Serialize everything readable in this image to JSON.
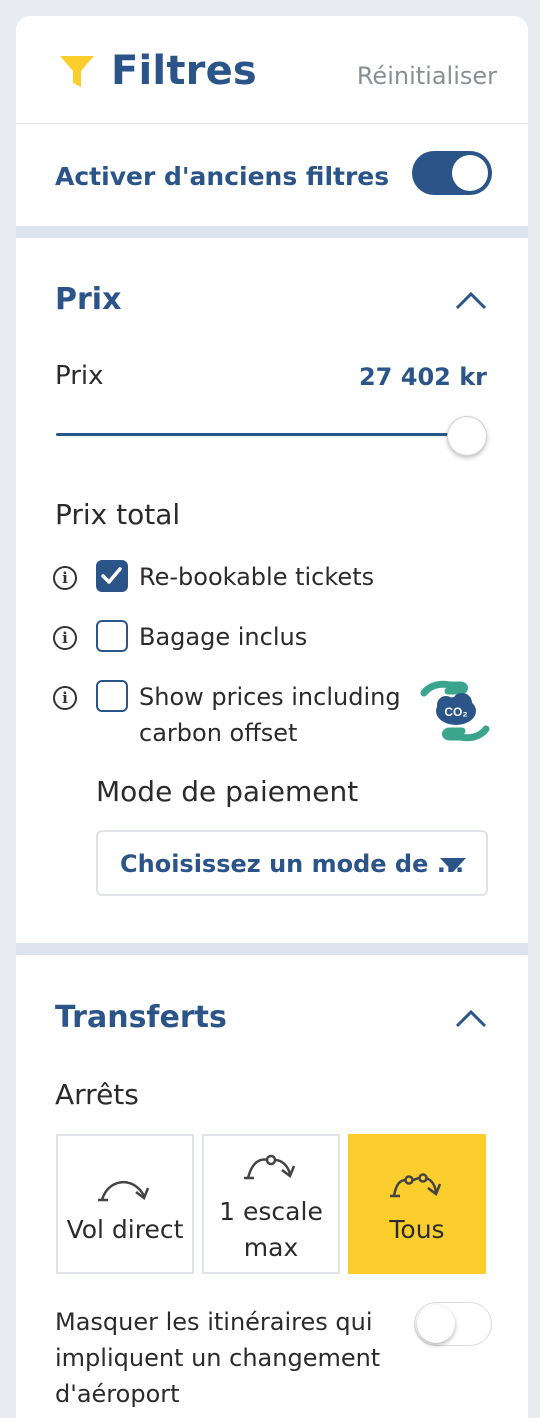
{
  "header": {
    "title": "Filtres",
    "reset_label": "Réinitialiser",
    "filter_icon": "funnel-icon",
    "accent_color": "#2b5589",
    "icon_color": "#fbcd2d"
  },
  "old_filters": {
    "label": "Activer d'anciens filtres",
    "enabled": true
  },
  "price_section": {
    "title": "Prix",
    "expanded": true,
    "price_label": "Prix",
    "price_value": "27 402 kr",
    "slider_fraction": 1.0,
    "total_label": "Prix total",
    "options": [
      {
        "label": "Re-bookable tickets",
        "checked": true,
        "icon": "info-icon"
      },
      {
        "label": "Bagage inclus",
        "checked": false,
        "icon": "info-icon"
      },
      {
        "label": "Show prices including carbon offset",
        "checked": false,
        "icon": "info-icon",
        "extra_icon": "co2-hands-icon"
      }
    ],
    "payment": {
      "label": "Mode de paiement",
      "placeholder": "Choisissez un mode de ..."
    }
  },
  "transfers_section": {
    "title": "Transferts",
    "expanded": true,
    "stops_label": "Arrêts",
    "stop_options": [
      {
        "label": "Vol direct",
        "icon": "direct-flight-icon",
        "selected": false
      },
      {
        "label": "1 escale max",
        "icon": "one-stop-icon",
        "selected": false
      },
      {
        "label": "Tous",
        "icon": "all-stops-icon",
        "selected": true
      }
    ],
    "selected_color": "#fbcd2d",
    "hide_airport_change": {
      "label": "Masquer les itinéraires qui impliquent un changement d'aéroport",
      "enabled": false
    }
  }
}
